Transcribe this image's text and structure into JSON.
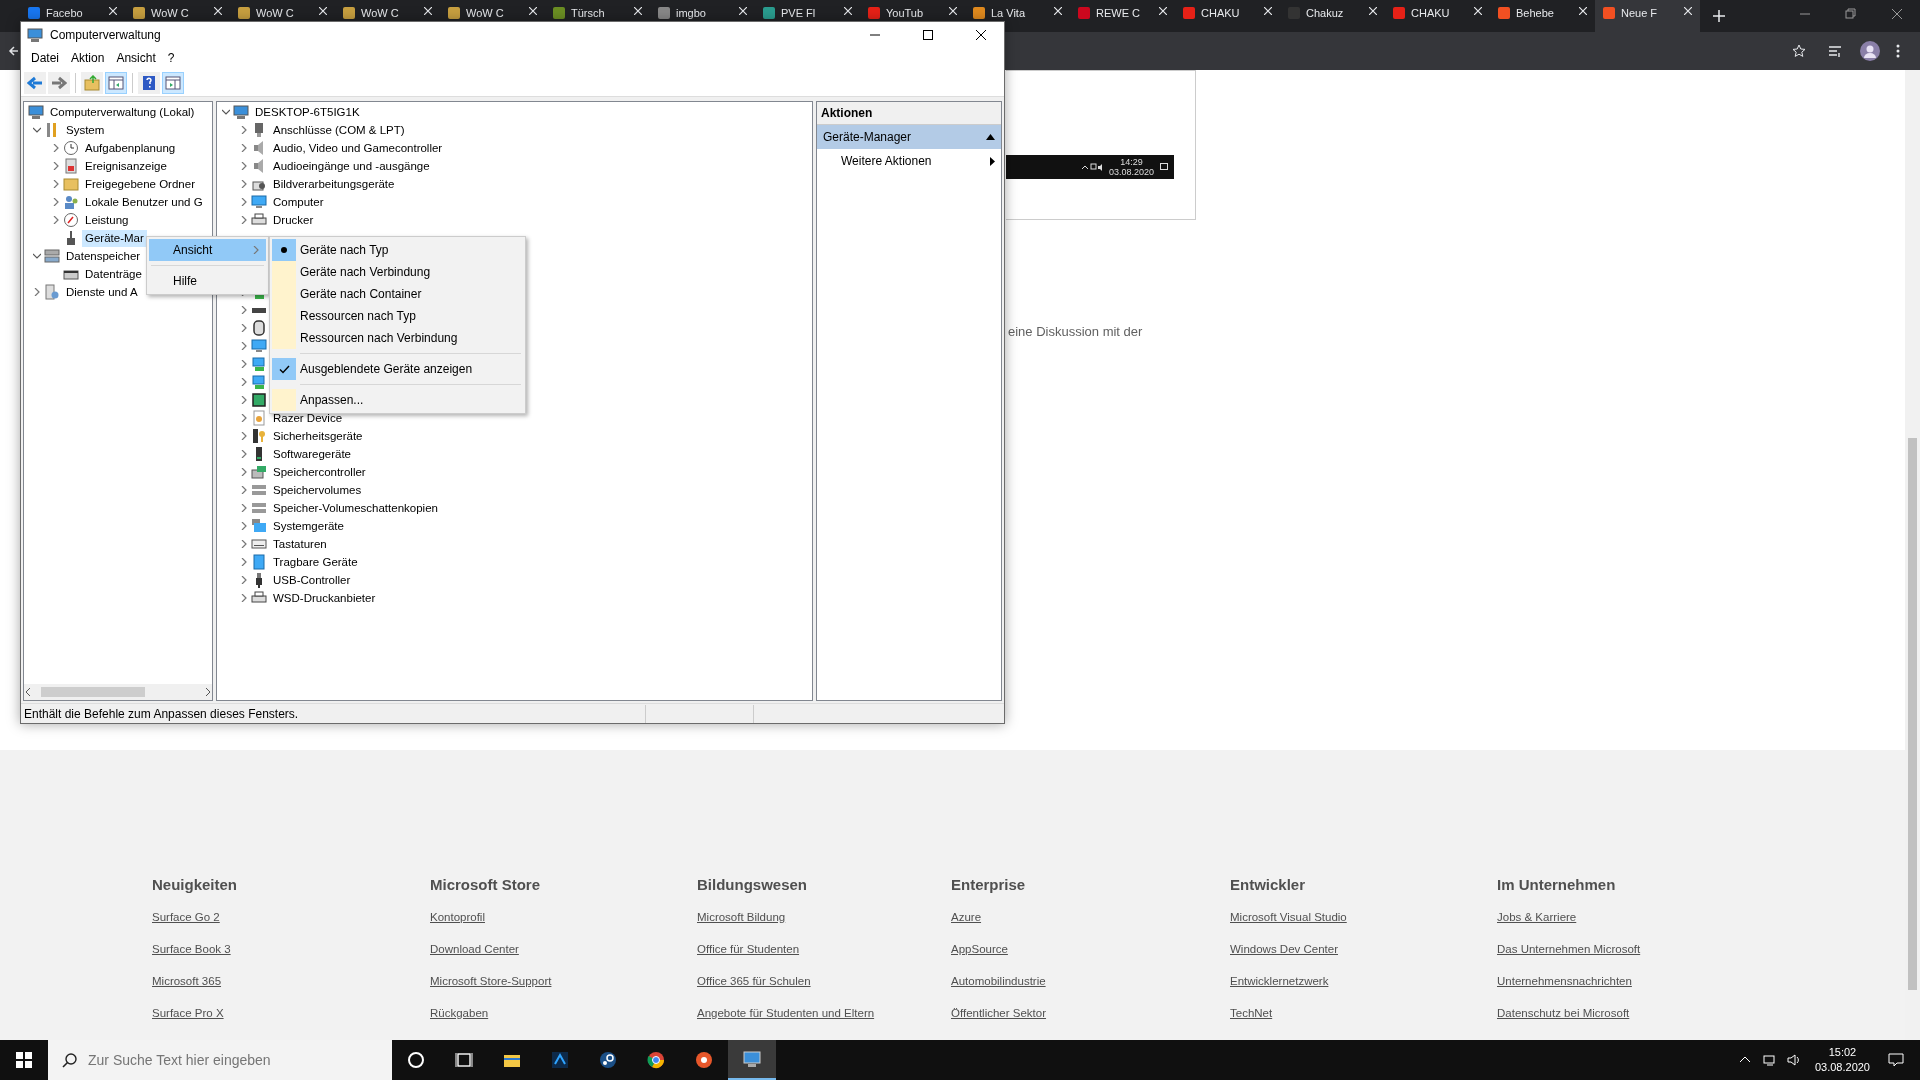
{
  "browser": {
    "tabs": [
      {
        "label": "Facebo",
        "selected": false
      },
      {
        "label": "WoW C",
        "selected": false
      },
      {
        "label": "WoW C",
        "selected": false
      },
      {
        "label": "WoW C",
        "selected": false
      },
      {
        "label": "WoW C",
        "selected": false
      },
      {
        "label": "Türsch",
        "selected": false
      },
      {
        "label": "imgbo",
        "selected": false
      },
      {
        "label": "PVE Fl",
        "selected": false
      },
      {
        "label": "YouTub",
        "selected": false
      },
      {
        "label": "La Vita",
        "selected": false
      },
      {
        "label": "REWE C",
        "selected": false
      },
      {
        "label": "CHAKU",
        "selected": false
      },
      {
        "label": "Chakuz",
        "selected": false
      },
      {
        "label": "CHAKU",
        "selected": false
      },
      {
        "label": "Behebe",
        "selected": false
      },
      {
        "label": "Neue F",
        "selected": true
      }
    ]
  },
  "page": {
    "snippet": {
      "time": "14:29",
      "date": "03.08.2020"
    },
    "text": "eine Diskussion mit der",
    "footer": [
      {
        "heading": "Neuigkeiten",
        "links": [
          "Surface Go 2",
          "Surface Book 3",
          "Microsoft 365",
          "Surface Pro X"
        ]
      },
      {
        "heading": "Microsoft Store",
        "links": [
          "Kontoprofil",
          "Download Center",
          "Microsoft Store-Support",
          "Rückgaben"
        ]
      },
      {
        "heading": "Bildungswesen",
        "links": [
          "Microsoft Bildung",
          "Office für Studenten",
          "Office 365 für Schulen",
          "Angebote für Studenten und Eltern"
        ]
      },
      {
        "heading": "Enterprise",
        "links": [
          "Azure",
          "AppSource",
          "Automobilindustrie",
          "Öffentlicher Sektor"
        ]
      },
      {
        "heading": "Entwickler",
        "links": [
          "Microsoft Visual Studio",
          "Windows Dev Center",
          "Entwicklernetzwerk",
          "TechNet"
        ]
      },
      {
        "heading": "Im Unternehmen",
        "links": [
          "Jobs & Karriere",
          "Das Unternehmen Microsoft",
          "Unternehmensnachrichten",
          "Datenschutz bei Microsoft"
        ]
      }
    ]
  },
  "window": {
    "title": "Computerverwaltung",
    "menu": [
      "Datei",
      "Aktion",
      "Ansicht",
      "?"
    ],
    "toolbar": [
      {
        "kind": "back",
        "pressed": false
      },
      {
        "kind": "forward",
        "pressed": false
      },
      {
        "kind": "separator"
      },
      {
        "kind": "up",
        "pressed": false
      },
      {
        "kind": "tree",
        "pressed": true
      },
      {
        "kind": "separator"
      },
      {
        "kind": "help",
        "pressed": false
      },
      {
        "kind": "pane",
        "pressed": true
      }
    ],
    "nav_tree": [
      {
        "label": "Computerverwaltung (Lokal)",
        "selected": false,
        "children": [
          {
            "label": "System",
            "expanded": true,
            "selected": false,
            "children": [
              {
                "label": "Aufgabenplanung",
                "expanded": false,
                "selected": false
              },
              {
                "label": "Ereignisanzeige",
                "expanded": false,
                "selected": false
              },
              {
                "label": "Freigegebene Ordner",
                "expanded": false,
                "selected": false
              },
              {
                "label": "Lokale Benutzer und G",
                "expanded": false,
                "selected": false
              },
              {
                "label": "Leistung",
                "expanded": false,
                "selected": false
              },
              {
                "label": "Geräte-Mar",
                "selected": true
              }
            ]
          },
          {
            "label": "Datenspeicher",
            "expanded": true,
            "selected": false,
            "children": [
              {
                "label": "Datenträge",
                "selected": false
              }
            ]
          },
          {
            "label": "Dienste und A",
            "expanded": false,
            "selected": false
          }
        ]
      }
    ],
    "device_tree": [
      {
        "kind": "device",
        "label": "DESKTOP-6T5IG1K",
        "expanded": true,
        "children": [
          {
            "kind": "device",
            "label": "Anschlüsse (COM & LPT)",
            "expanded": false
          },
          {
            "kind": "device",
            "label": "Audio, Video und Gamecontroller",
            "expanded": false
          },
          {
            "kind": "device",
            "label": "Audioeingänge und -ausgänge",
            "expanded": false
          },
          {
            "kind": "device",
            "label": "Bildverarbeitungsgeräte",
            "expanded": false
          },
          {
            "kind": "device",
            "label": "Computer",
            "expanded": false
          },
          {
            "kind": "device",
            "label": "Drucker",
            "expanded": false
          },
          {
            "kind": "covered"
          },
          {
            "kind": "covered"
          },
          {
            "kind": "covered"
          },
          {
            "kind": "icon_only",
            "expanded": false
          },
          {
            "kind": "icon_only",
            "expanded": false
          },
          {
            "kind": "icon_only",
            "expanded": false
          },
          {
            "kind": "icon_only",
            "expanded": false
          },
          {
            "kind": "icon_only",
            "expanded": false
          },
          {
            "kind": "icon_only",
            "expanded": false
          },
          {
            "kind": "icon_only",
            "expanded": false
          },
          {
            "kind": "device",
            "label": "Razer Device",
            "expanded": false
          },
          {
            "kind": "device",
            "label": "Sicherheitsgeräte",
            "expanded": false
          },
          {
            "kind": "device",
            "label": "Softwaregeräte",
            "expanded": false
          },
          {
            "kind": "device",
            "label": "Speichercontroller",
            "expanded": false
          },
          {
            "kind": "device",
            "label": "Speichervolumes",
            "expanded": false
          },
          {
            "kind": "device",
            "label": "Speicher-Volumeschattenkopien",
            "expanded": false
          },
          {
            "kind": "device",
            "label": "Systemgeräte",
            "expanded": false
          },
          {
            "kind": "device",
            "label": "Tastaturen",
            "expanded": false
          },
          {
            "kind": "device",
            "label": "Tragbare Geräte",
            "expanded": false
          },
          {
            "kind": "device",
            "label": "USB-Controller",
            "expanded": false
          },
          {
            "kind": "device",
            "label": "WSD-Druckanbieter",
            "expanded": false
          }
        ]
      }
    ],
    "actions": {
      "header": "Aktionen",
      "section": "Geräte-Manager",
      "items": [
        "Weitere Aktionen"
      ]
    },
    "status_bar": {
      "text": "Enthält die Befehle zum Anpassen dieses Fensters."
    },
    "context_menu": {
      "items": [
        {
          "kind": "submenu",
          "label": "Ansicht",
          "selected": true
        },
        {
          "kind": "separator"
        },
        {
          "kind": "item",
          "label": "Hilfe",
          "selected": false
        }
      ]
    },
    "submenu": {
      "items": [
        {
          "kind": "radio",
          "label": "Geräte nach Typ",
          "checked": true
        },
        {
          "kind": "radio",
          "label": "Geräte nach Verbindung",
          "checked": false
        },
        {
          "kind": "radio",
          "label": "Geräte nach Container",
          "checked": false
        },
        {
          "kind": "radio",
          "label": "Ressourcen nach Typ",
          "checked": false
        },
        {
          "kind": "radio",
          "label": "Ressourcen nach Verbindung",
          "checked": false
        },
        {
          "kind": "separator"
        },
        {
          "kind": "check",
          "label": "Ausgeblendete Geräte anzeigen",
          "checked": true
        },
        {
          "kind": "separator"
        },
        {
          "kind": "item",
          "label": "Anpassen..."
        }
      ]
    }
  },
  "taskbar": {
    "search": {
      "placeholder": "Zur Suche Text hier eingeben"
    },
    "apps": [
      {
        "selected": false
      },
      {
        "selected": false
      },
      {
        "selected": false
      },
      {
        "selected": false
      },
      {
        "selected": false
      },
      {
        "selected": false
      },
      {
        "selected": false
      },
      {
        "selected": true
      }
    ],
    "time": "15:02",
    "date": "03.08.2020"
  }
}
